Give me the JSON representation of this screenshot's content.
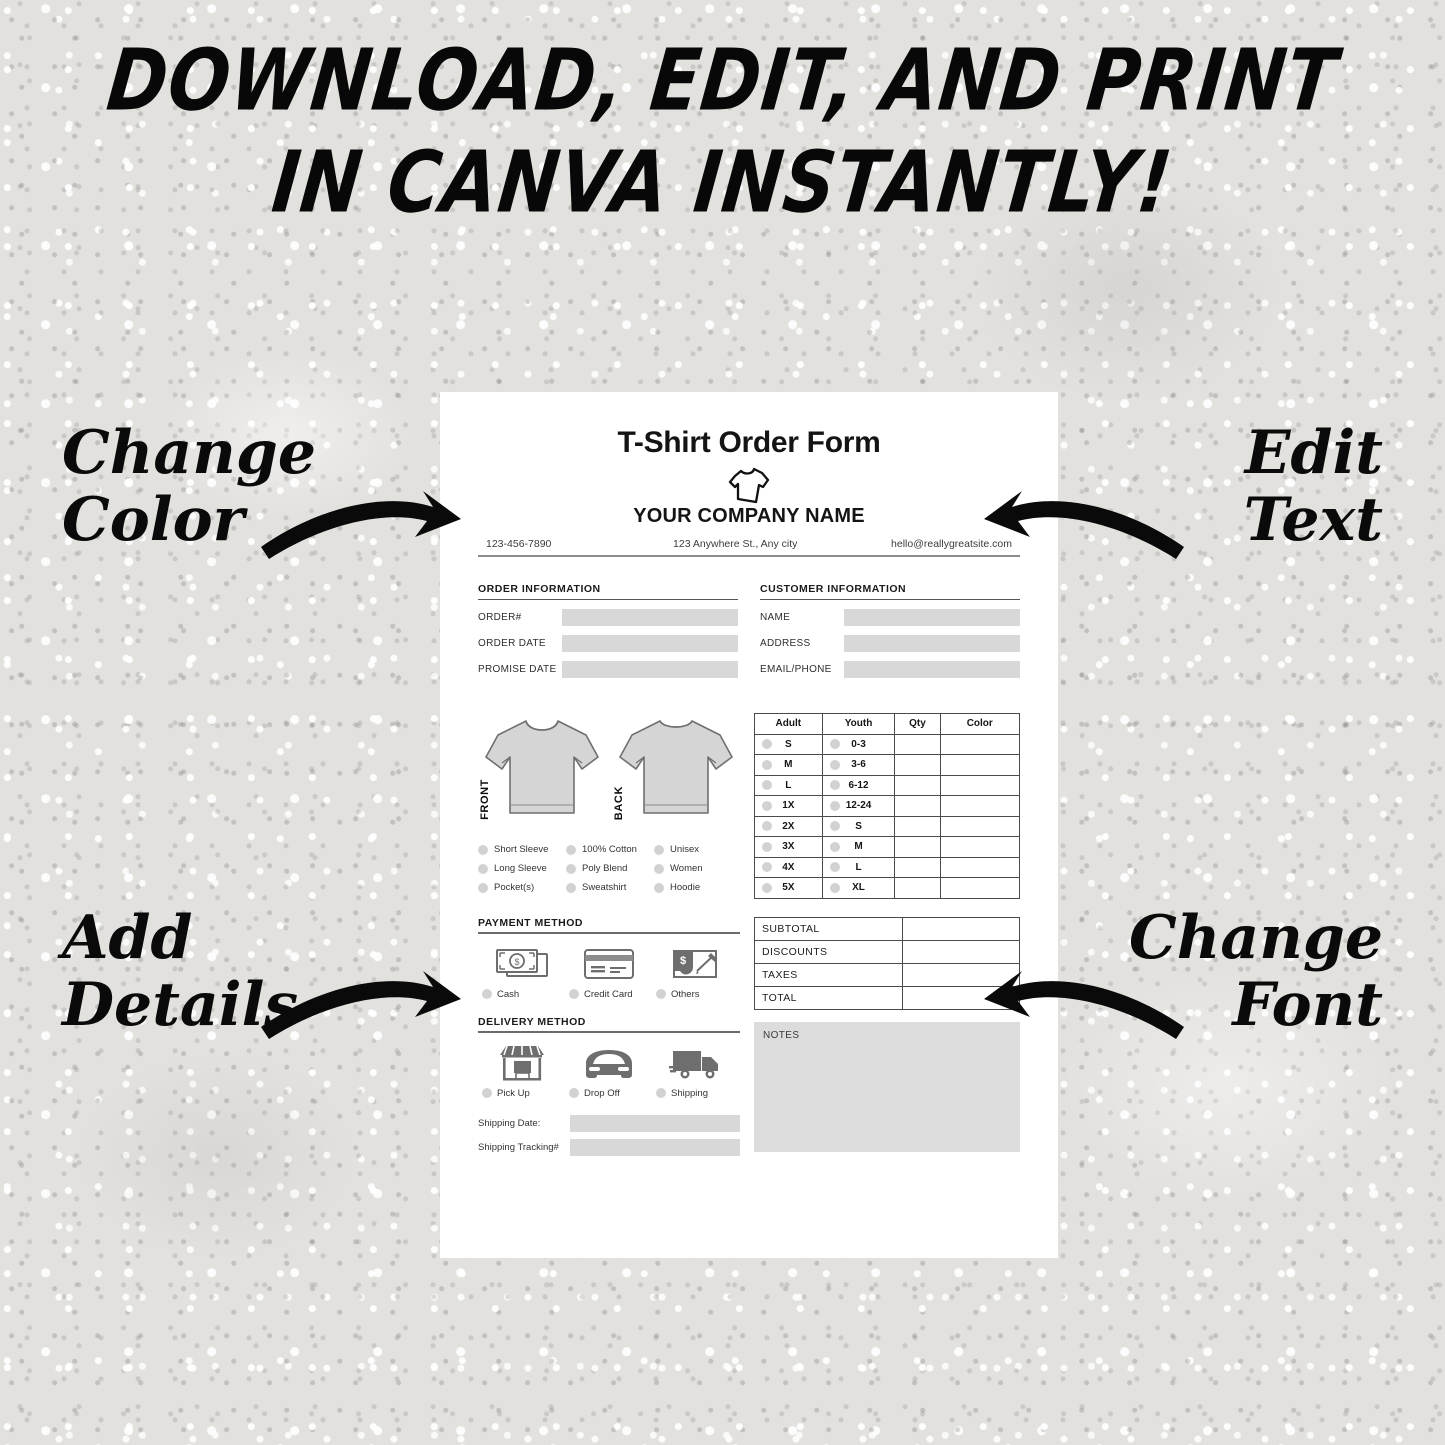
{
  "headline": {
    "line1": "DOWNLOAD, EDIT, AND PRINT",
    "line2": "IN CANVA INSTANTLY!"
  },
  "annotations": {
    "top_left": "Change\nColor",
    "top_right": "Edit\nText",
    "bottom_left": "Add\nDetails",
    "bottom_right": "Change\nFont"
  },
  "document": {
    "title": "T-Shirt Order Form",
    "company": "YOUR COMPANY NAME",
    "contact": {
      "phone": "123-456-7890",
      "address": "123 Anywhere St., Any city",
      "email": "hello@reallygreatsite.com"
    },
    "order_information": {
      "heading": "ORDER INFORMATION",
      "fields": [
        {
          "label": "ORDER#",
          "value": ""
        },
        {
          "label": "ORDER DATE",
          "value": ""
        },
        {
          "label": "PROMISE DATE",
          "value": ""
        }
      ]
    },
    "customer_information": {
      "heading": "CUSTOMER INFORMATION",
      "fields": [
        {
          "label": "NAME",
          "value": ""
        },
        {
          "label": "ADDRESS",
          "value": ""
        },
        {
          "label": "EMAIL/PHONE",
          "value": ""
        }
      ]
    },
    "shirts": {
      "front_label": "FRONT",
      "back_label": "BACK"
    },
    "options": [
      "Short Sleeve",
      "100% Cotton",
      "Unisex",
      "Long Sleeve",
      "Poly Blend",
      "Women",
      "Pocket(s)",
      "Sweatshirt",
      "Hoodie"
    ],
    "size_table": {
      "columns": [
        "Adult",
        "Youth",
        "Qty",
        "Color"
      ],
      "rows": [
        {
          "adult": "S",
          "youth": "0-3",
          "qty": "",
          "color": ""
        },
        {
          "adult": "M",
          "youth": "3-6",
          "qty": "",
          "color": ""
        },
        {
          "adult": "L",
          "youth": "6-12",
          "qty": "",
          "color": ""
        },
        {
          "adult": "1X",
          "youth": "12-24",
          "qty": "",
          "color": ""
        },
        {
          "adult": "2X",
          "youth": "S",
          "qty": "",
          "color": ""
        },
        {
          "adult": "3X",
          "youth": "M",
          "qty": "",
          "color": ""
        },
        {
          "adult": "4X",
          "youth": "L",
          "qty": "",
          "color": ""
        },
        {
          "adult": "5X",
          "youth": "XL",
          "qty": "",
          "color": ""
        }
      ]
    },
    "payment_method": {
      "heading": "PAYMENT METHOD",
      "options": [
        {
          "label": "Cash",
          "icon": "cash-icon"
        },
        {
          "label": "Credit Card",
          "icon": "credit-card-icon"
        },
        {
          "label": "Others",
          "icon": "check-pen-icon"
        }
      ]
    },
    "delivery_method": {
      "heading": "DELIVERY METHOD",
      "options": [
        {
          "label": "Pick Up",
          "icon": "storefront-icon"
        },
        {
          "label": "Drop Off",
          "icon": "car-icon"
        },
        {
          "label": "Shipping",
          "icon": "truck-icon"
        }
      ]
    },
    "shipping_fields": [
      {
        "label": "Shipping Date:",
        "value": ""
      },
      {
        "label": "Shipping Tracking#",
        "value": ""
      }
    ],
    "totals": [
      {
        "label": "SUBTOTAL",
        "value": ""
      },
      {
        "label": "DISCOUNTS",
        "value": ""
      },
      {
        "label": "TAXES",
        "value": ""
      },
      {
        "label": "TOTAL",
        "value": ""
      }
    ],
    "notes_label": "NOTES"
  },
  "colors": {
    "background": "#e3e1de",
    "card": "#ffffff",
    "field_fill": "#d8d8d8",
    "notes_fill": "#dcdcdc",
    "radio_fill": "#d2d2d2",
    "ink": "#141414",
    "rule": "#4a4a4a",
    "shirt_fill": "#d5d5d5",
    "icon_gray": "#6e6e6e"
  }
}
